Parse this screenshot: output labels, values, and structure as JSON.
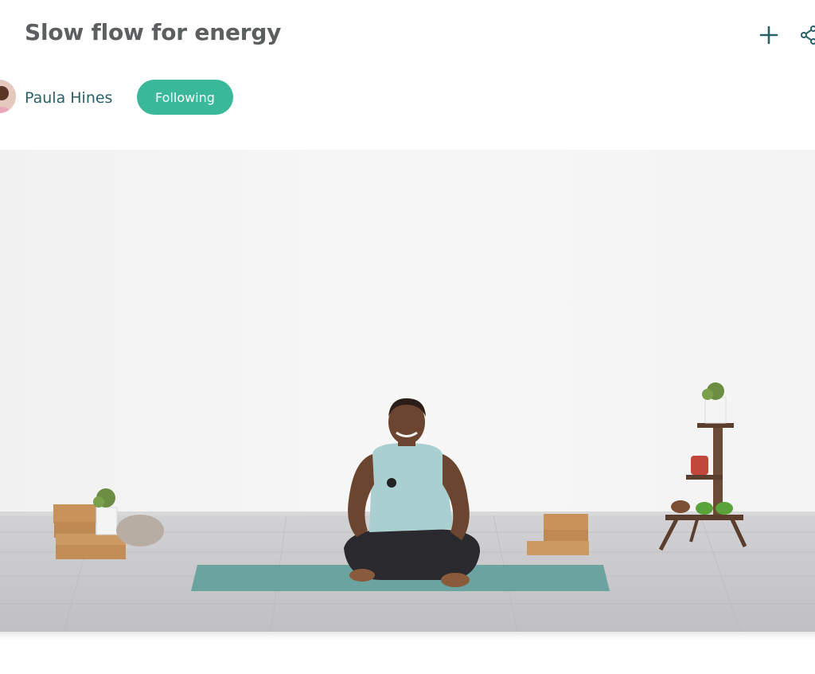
{
  "page": {
    "title": "Slow flow for energy"
  },
  "toolbar": {
    "add_icon": "plus-icon",
    "share_icon": "share-icon"
  },
  "author": {
    "name": "Paula Hines",
    "follow_label": "Following"
  },
  "video": {
    "content": "instructor-seated-on-mat"
  },
  "colors": {
    "accent": "#39b89a",
    "title": "#5b5f60",
    "author": "#2b6066",
    "icon": "#2b6066"
  }
}
